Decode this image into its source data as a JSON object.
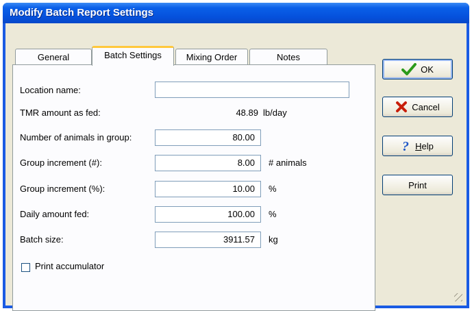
{
  "window": {
    "title": "Modify Batch Report Settings"
  },
  "tabs": [
    {
      "label": "General"
    },
    {
      "label": "Batch Settings"
    },
    {
      "label": "Mixing Order"
    },
    {
      "label": "Notes"
    }
  ],
  "form": {
    "location_label": "Location name:",
    "location_value": "",
    "tmr_label": "TMR amount as fed:",
    "tmr_value": "48.89",
    "tmr_unit": "lb/day",
    "animals_label": "Number of animals in group:",
    "animals_value": "80.00",
    "inc_num_label": "Group increment (#):",
    "inc_num_value": "8.00",
    "inc_num_unit": "# animals",
    "inc_pct_label": "Group increment (%):",
    "inc_pct_value": "10.00",
    "inc_pct_unit": "%",
    "daily_label": "Daily amount fed:",
    "daily_value": "100.00",
    "daily_unit": "%",
    "batch_label": "Batch size:",
    "batch_value": "3911.57",
    "batch_unit": "kg",
    "accum_label": "Print accumulator"
  },
  "buttons": {
    "ok": "OK",
    "cancel": "Cancel",
    "help_prefix": "",
    "help_mnemonic": "H",
    "help_rest": "elp",
    "print": "Print"
  },
  "colors": {
    "ok_check": "#2a9a1a",
    "cancel_x": "#c81e0a",
    "help_q": "#1f57c8"
  }
}
